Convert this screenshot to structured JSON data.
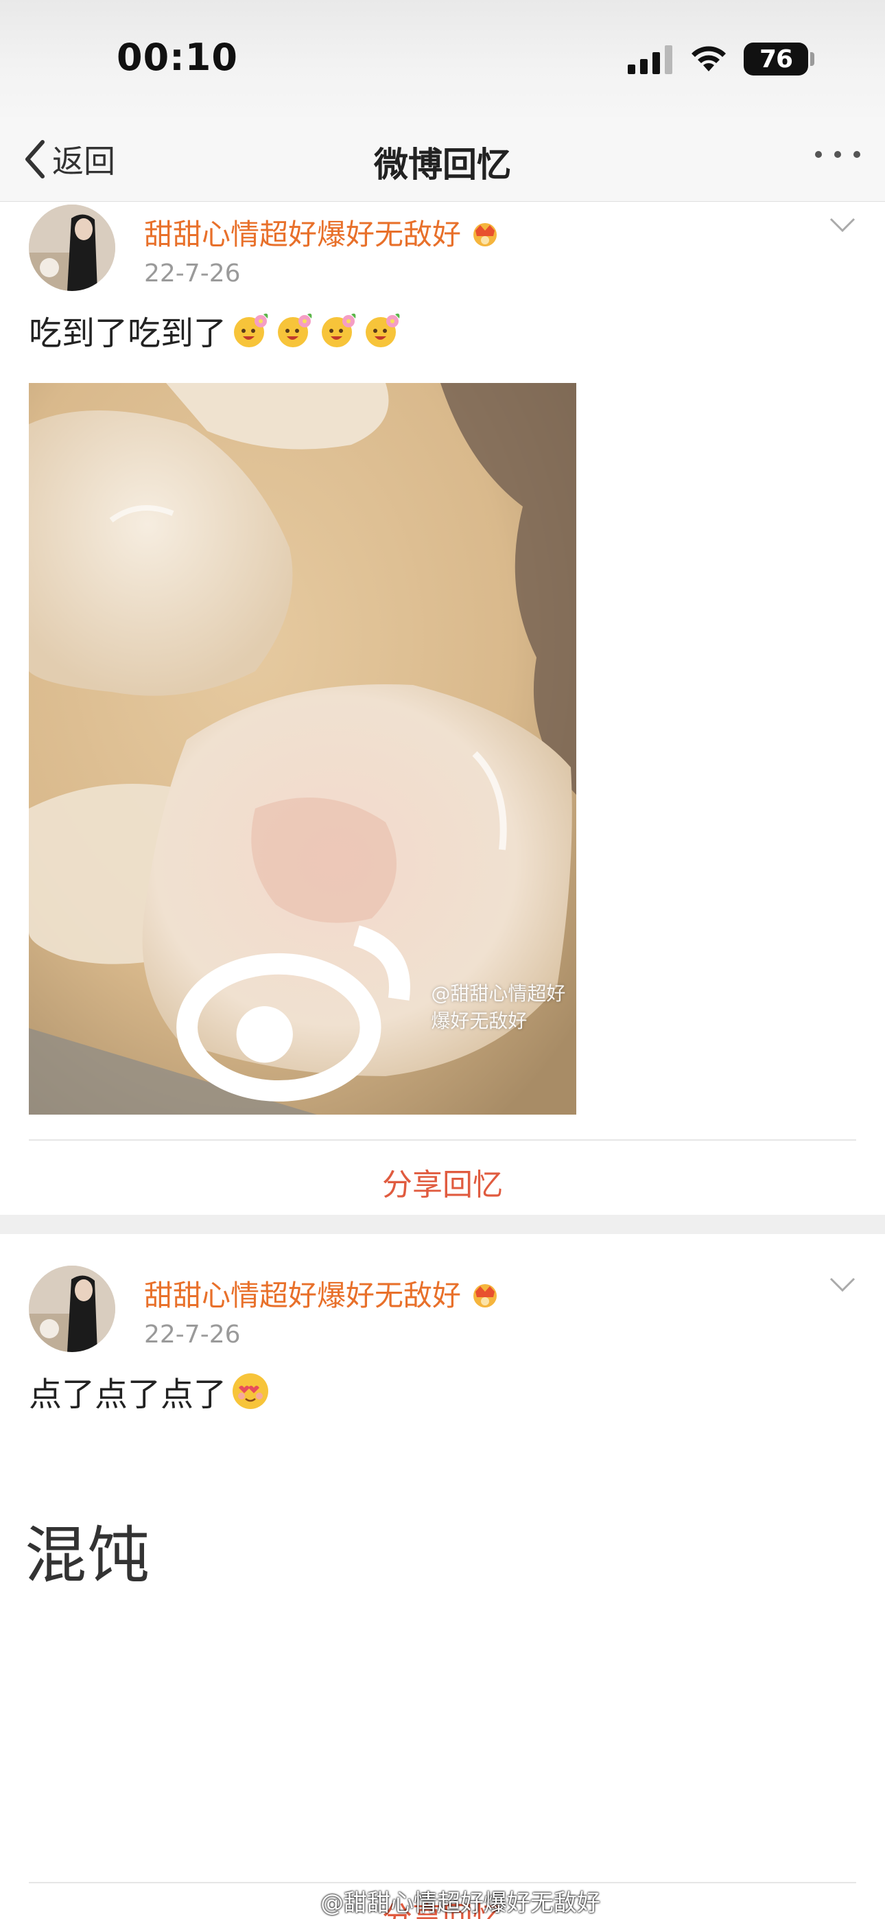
{
  "status_bar": {
    "time": "00:10",
    "battery": "76"
  },
  "nav": {
    "back_label": "返回",
    "title": "微博回忆"
  },
  "posts": [
    {
      "username": "甜甜心情超好爆好无敌好",
      "date": "22-7-26",
      "text": "吃到了吃到了",
      "emojis": [
        "flower-face-emoji",
        "flower-face-emoji",
        "flower-face-emoji",
        "flower-face-emoji"
      ],
      "image_watermark": "@甜甜心情超好爆好无敌好",
      "share_label": "分享回忆"
    },
    {
      "username": "甜甜心情超好爆好无敌好",
      "date": "22-7-26",
      "text": "点了点了点了",
      "emojis": [
        "heart-eyes-emoji"
      ],
      "big_text": "混饨",
      "share_label": "分享回忆"
    }
  ],
  "bottom_watermark": "@甜甜心情超好爆好无敌好",
  "colors": {
    "username": "#e8702a",
    "share": "#e05b3f",
    "date": "#9a9a9a"
  }
}
